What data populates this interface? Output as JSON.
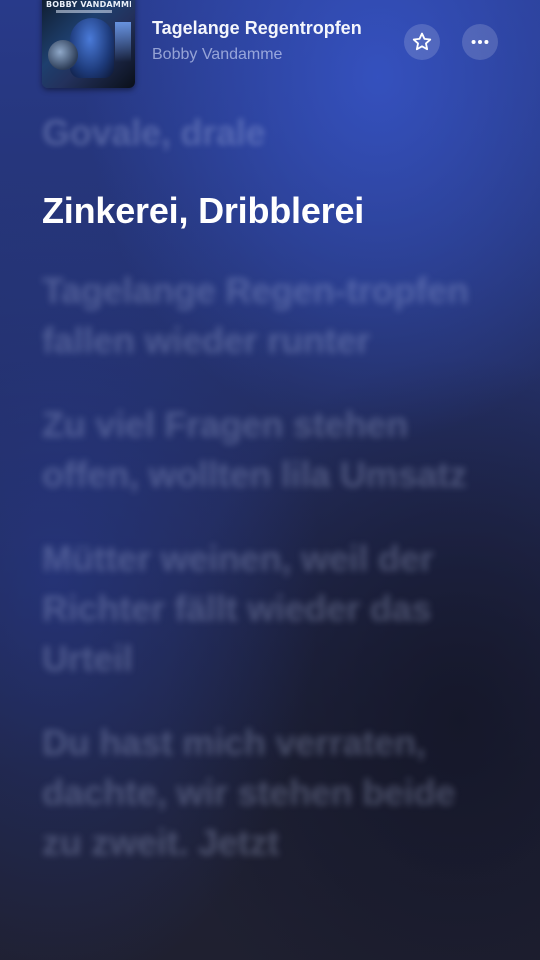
{
  "now_playing": {
    "cover_artist_text": "BOBBY VANDAMME",
    "title": "Tagelange Regentropfen",
    "artist": "Bobby Vandamme"
  },
  "icons": {
    "favorite": "star-icon",
    "more": "more-horizontal-icon"
  },
  "lyrics": {
    "previous": "Govale, drale",
    "current": "Zinkerei, Dribblerei",
    "upcoming": [
      "Tagelange Regen-tropfen fallen wieder runter",
      "Zu viel Fragen stehen offen, wollten lila Umsatz",
      "Mütter weinen, weil der Richter fällt wieder das Urteil",
      "Du hast mich verraten, dachte, wir stehen beide zu zweit. Jetzt"
    ]
  },
  "colors": {
    "background_top": "#283a8a",
    "background_bottom": "#1f2030",
    "active_lyric": "#ffffff"
  }
}
